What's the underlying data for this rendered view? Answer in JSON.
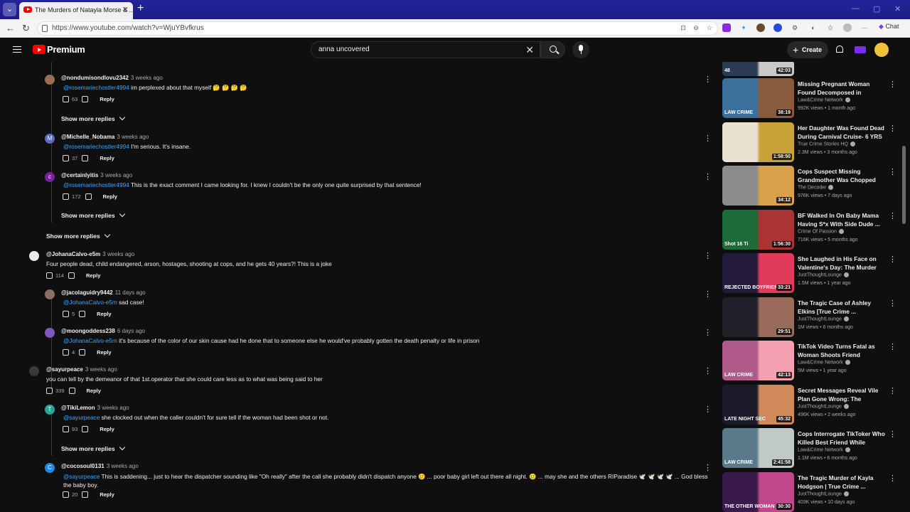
{
  "browser": {
    "tab_title": "The Murders of Natayla Morse & ...",
    "url": "https://www.youtube.com/watch?v=WjuYBvfkrus",
    "chat_label": "Chat"
  },
  "yt": {
    "logo_text": "Premium",
    "search_value": "anna uncovered",
    "create_label": "Create"
  },
  "comments": [
    {
      "type": "reply",
      "user": "@nondumisondlovu2342",
      "time": "3 weeks ago",
      "mention": "@rosemariechostler4994",
      "text": " im perplexed about that myself 🤔 🤔 🤔 🤔",
      "likes": "63",
      "avatar_color": "#9a6f5a",
      "avatar_letter": ""
    },
    {
      "type": "showmore",
      "label": "Show more replies"
    },
    {
      "type": "reply",
      "user": "@Michelle_Nobama",
      "time": "3 weeks ago",
      "mention": "@rosemariechostler4994",
      "text": " I'm serious. It's insane.",
      "likes": "37",
      "avatar_color": "#5c6bc0",
      "avatar_letter": "M"
    },
    {
      "type": "reply",
      "user": "@certainlyitis",
      "time": "3 weeks ago",
      "mention": "@rosemariechostler4994",
      "text": " This is the exact comment I came looking for. I knew I couldn't be the only one quite surprised by that sentence!",
      "likes": "172",
      "avatar_color": "#7b1fa2",
      "avatar_letter": "c"
    },
    {
      "type": "showmore",
      "label": "Show more replies"
    },
    {
      "type": "showmore_top",
      "label": "Show more replies"
    },
    {
      "type": "top",
      "user": "@JohanaCalvo-e5m",
      "time": "3 weeks ago",
      "mention": "",
      "text": "Four people dead, child endangered, arson, hostages, shooting at cops, and he gets 40 years?! This is a joke",
      "likes": "114",
      "avatar_color": "#eeeeee",
      "avatar_letter": ""
    },
    {
      "type": "reply",
      "user": "@jacolaguidry9442",
      "time": "11 days ago",
      "mention": "@JohanaCalvo-e5m",
      "text": " sad case!",
      "likes": "5",
      "avatar_color": "#8d6e63",
      "avatar_letter": ""
    },
    {
      "type": "reply",
      "user": "@moongoddess238",
      "time": "6 days ago",
      "mention": "@JohanaCalvo-e5m",
      "text": " it's because of the color of our skin cause had he done that to someone else he would've probably gotten the death penalty or life in prison",
      "likes": "4",
      "avatar_color": "#7e57c2",
      "avatar_letter": ""
    },
    {
      "type": "top",
      "user": "@sayurpeace",
      "time": "3 weeks ago",
      "mention": "",
      "text": "you can tell by the demeanor of that 1st.operator that she could care less as to what was being said to her",
      "likes": "339",
      "avatar_color": "#3a3a3a",
      "avatar_letter": ""
    },
    {
      "type": "reply",
      "user": "@TikiLemon",
      "time": "3 weeks ago",
      "mention": "@sayurpeace",
      "text": " she clocked out when the caller couldn't for sure tell if the woman had been shot or not.",
      "likes": "93",
      "avatar_color": "#26a69a",
      "avatar_letter": "T"
    },
    {
      "type": "showmore",
      "label": "Show more replies"
    },
    {
      "type": "reply_wrap",
      "user": "@cocosoul0131",
      "time": "3 weeks ago",
      "mention": "@sayurpeace",
      "text": " This is saddening... just to hear the dispatcher sounding like \"Oh really\" after the call she probably didn't dispatch anyone 🥲 ... poor baby girl left out there all night. 🥲 ... may she and the others RIParadise 🕊️ 🕊️ 🕊️ 🕊️ ... God bless the baby boy.",
      "likes": "20",
      "avatar_color": "#1e88e5",
      "avatar_letter": "C"
    }
  ],
  "videos": [
    {
      "title": "",
      "channel": "",
      "meta": "",
      "duration": "42:03",
      "thumb": "#2b3a55",
      "thumb2": "#c9c9c9",
      "badge": "48"
    },
    {
      "title": "Missing Pregnant Woman Found Decomposed in Maryla...",
      "channel": "Law&Crime Network",
      "meta": "992K views • 1 month ago",
      "duration": "38:19",
      "thumb": "#3d6f9c",
      "thumb2": "#8a5a3c",
      "badge": "LAW CRIME"
    },
    {
      "title": "Her Daughter Was Found Dead During Carnival Cruise- 6 YRS ...",
      "channel": "True Crime Stories HQ",
      "meta": "2.3M views • 3 months ago",
      "duration": "1:58:50",
      "thumb": "#e8e0d0",
      "thumb2": "#caa23a",
      "badge": ""
    },
    {
      "title": "Cops Suspect Missing Grandmother Was Chopped U...",
      "channel": "The Decoder",
      "meta": "976K views • 7 days ago",
      "duration": "34:12",
      "thumb": "#8c8c8c",
      "thumb2": "#d9a24a",
      "badge": ""
    },
    {
      "title": "BF Walked In On Baby Mama Having S*x With Side Dude ...",
      "channel": "Crime Of Passion",
      "meta": "716K views • 5 months ago",
      "duration": "1:56:30",
      "thumb": "#1e6b3a",
      "thumb2": "#a33",
      "badge": "Shot 16 Ti"
    },
    {
      "title": "She Laughed in His Face on Valentine's Day: The Murder of...",
      "channel": "JustThoughtLounge",
      "meta": "1.5M views • 1 year ago",
      "duration": "33:21",
      "thumb": "#241a3a",
      "thumb2": "#e23a5a",
      "badge": "REJECTED BOYFRIEND"
    },
    {
      "title": "The Tragic Case of Ashley Elkins [True Crime ...",
      "channel": "JustThoughtLounge",
      "meta": "1M views • 6 months ago",
      "duration": "29:51",
      "thumb": "#202028",
      "thumb2": "#9a6a5a",
      "badge": ""
    },
    {
      "title": "TikTok Video Turns Fatal as Woman Shoots Friend",
      "channel": "Law&Crime Network",
      "meta": "5M views • 1 year ago",
      "duration": "42:13",
      "thumb": "#b05a8a",
      "thumb2": "#f5a0b0",
      "badge": "LAW CRIME"
    },
    {
      "title": "Secret Messages Reveal Vile Plan Gone Wrong: The Murder...",
      "channel": "JustThoughtLounge",
      "meta": "496K views • 2 weeks ago",
      "duration": "45:32",
      "thumb": "#1a1a2a",
      "thumb2": "#d08a5a",
      "badge": "LATE NIGHT SEC"
    },
    {
      "title": "Cops Interrogate TikToker Who Killed Best Friend While Trying...",
      "channel": "Law&Crime Network",
      "meta": "1.1M views • 6 months ago",
      "duration": "2:41:58",
      "thumb": "#5a7a8a",
      "thumb2": "#c0c8c8",
      "badge": "LAW CRIME"
    },
    {
      "title": "The Tragic Murder of Kayla Hodgson | True Crime ...",
      "channel": "JustThoughtLounge",
      "meta": "403K views • 10 days ago",
      "duration": "30:30",
      "thumb": "#3a1a4a",
      "thumb2": "#c0488a",
      "badge": "THE OTHER WOMAN"
    }
  ]
}
